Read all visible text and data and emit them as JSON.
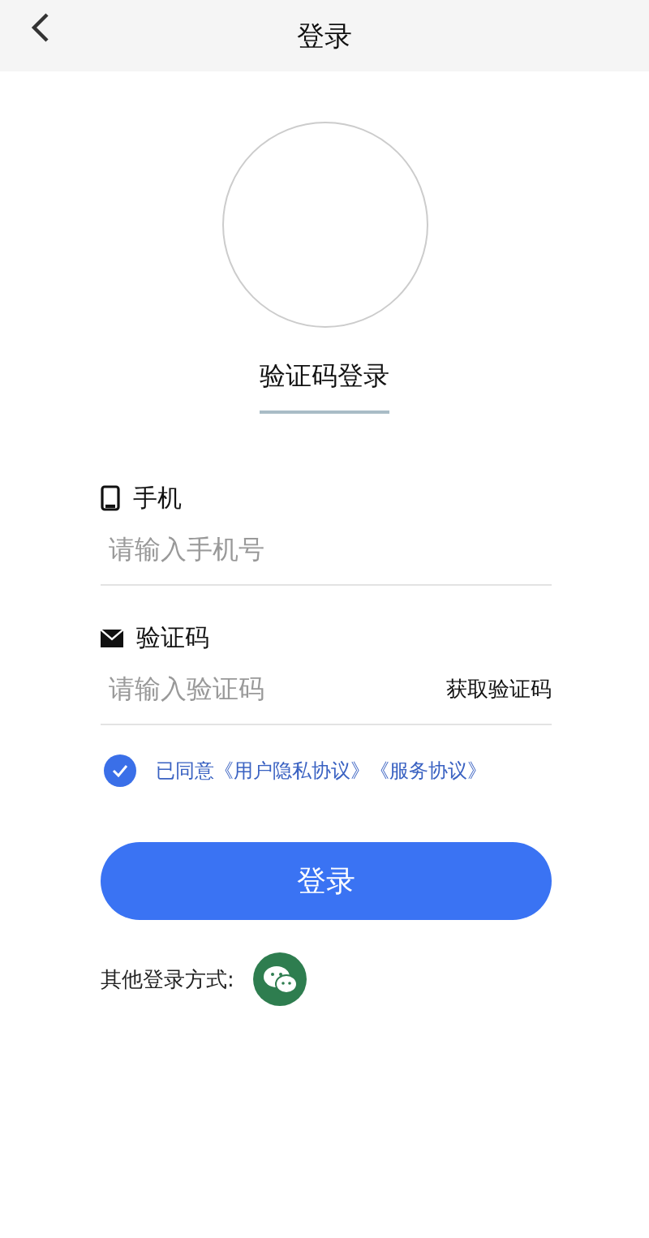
{
  "header": {
    "title": "登录"
  },
  "avatar": {
    "kind": "empty"
  },
  "tabs": [
    {
      "label": "验证码登录",
      "selected": true
    }
  ],
  "fields": [
    {
      "kind": "phone",
      "label": "手机",
      "placeholder": "请输入手机号"
    },
    {
      "kind": "code",
      "label": "验证码",
      "placeholder": "请输入验证码",
      "action": "获取验证码"
    }
  ],
  "agreement": {
    "checked": true,
    "prefix": "已同意",
    "links": [
      "《用户隐私协议》",
      "《服务协议》"
    ]
  },
  "login_button": "登录",
  "other_login": {
    "label": "其他登录方式:",
    "methods": [
      {
        "kind": "wechat"
      }
    ]
  }
}
